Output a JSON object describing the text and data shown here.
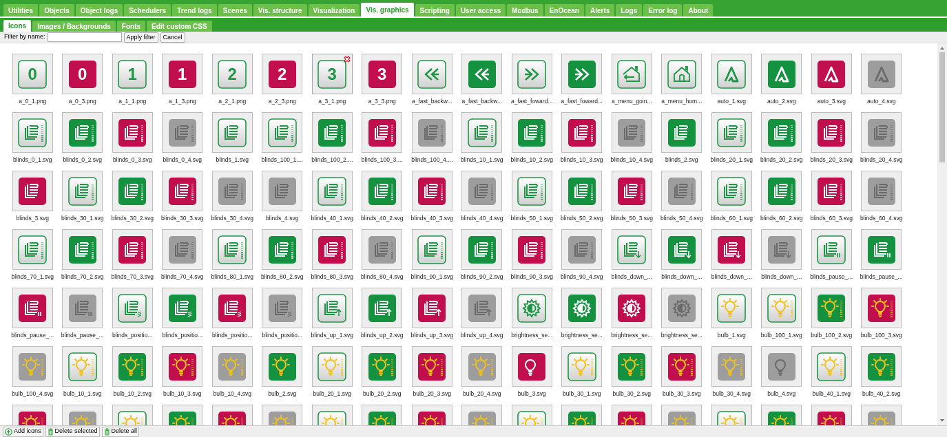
{
  "tabs": [
    {
      "label": "Utilities",
      "selected": false
    },
    {
      "label": "Objects",
      "selected": false
    },
    {
      "label": "Object logs",
      "selected": false
    },
    {
      "label": "Schedulers",
      "selected": false
    },
    {
      "label": "Trend logs",
      "selected": false
    },
    {
      "label": "Scenes",
      "selected": false
    },
    {
      "label": "Vis. structure",
      "selected": false
    },
    {
      "label": "Visualization",
      "selected": false
    },
    {
      "label": "Vis. graphics",
      "selected": true
    },
    {
      "label": "Scripting",
      "selected": false
    },
    {
      "label": "User access",
      "selected": false
    },
    {
      "label": "Modbus",
      "selected": false
    },
    {
      "label": "EnOcean",
      "selected": false
    },
    {
      "label": "Alerts",
      "selected": false
    },
    {
      "label": "Logs",
      "selected": false
    },
    {
      "label": "Error log",
      "selected": false
    },
    {
      "label": "About",
      "selected": false
    }
  ],
  "subtabs": [
    {
      "label": "Icons",
      "selected": true
    },
    {
      "label": "Images / Backgrounds",
      "selected": false
    },
    {
      "label": "Fonts",
      "selected": false
    },
    {
      "label": "Edit custom CSS",
      "selected": false
    }
  ],
  "filter": {
    "label": "Filter by name:",
    "buttons": [
      "Apply filter",
      "Cancel"
    ]
  },
  "icons": [
    {
      "name": "a_0_1.png",
      "kind": "digit",
      "text": "0",
      "filled": false,
      "color": "#1f9646",
      "scale": false,
      "marked": false
    },
    {
      "name": "a_0_3.png",
      "kind": "digit",
      "text": "0",
      "filled": true,
      "color": "#c10e4d",
      "scale": false,
      "marked": false
    },
    {
      "name": "a_1_1.png",
      "kind": "digit",
      "text": "1",
      "filled": false,
      "color": "#1f9646",
      "scale": false,
      "marked": false
    },
    {
      "name": "a_1_3.png",
      "kind": "digit",
      "text": "1",
      "filled": true,
      "color": "#c10e4d",
      "scale": false,
      "marked": false
    },
    {
      "name": "a_2_1.png",
      "kind": "digit",
      "text": "2",
      "filled": false,
      "color": "#1f9646",
      "scale": false,
      "marked": false
    },
    {
      "name": "a_2_3.png",
      "kind": "digit",
      "text": "2",
      "filled": true,
      "color": "#c10e4d",
      "scale": false,
      "marked": false
    },
    {
      "name": "a_3_1.png",
      "kind": "digit",
      "text": "3",
      "filled": false,
      "color": "#1f9646",
      "scale": false,
      "marked": true
    },
    {
      "name": "a_3_3.png",
      "kind": "digit",
      "text": "3",
      "filled": true,
      "color": "#c10e4d",
      "scale": false,
      "marked": false
    },
    {
      "name": "a_fast_backw...",
      "kind": "rewind",
      "filled": false,
      "color": "#1f9646",
      "scale": false,
      "marked": false
    },
    {
      "name": "a_fast_backw...",
      "kind": "rewind",
      "filled": true,
      "color": "#14923f",
      "scale": false,
      "marked": false
    },
    {
      "name": "a_fast_foward...",
      "kind": "forward",
      "filled": false,
      "color": "#1f9646",
      "scale": false,
      "marked": false
    },
    {
      "name": "a_fast_foward...",
      "kind": "forward",
      "filled": true,
      "color": "#14923f",
      "scale": false,
      "marked": false
    },
    {
      "name": "a_menu_goin...",
      "kind": "home_back",
      "filled": false,
      "color": "#1f9646",
      "scale": false,
      "marked": false
    },
    {
      "name": "a_menu_hom...",
      "kind": "home",
      "filled": false,
      "color": "#1f9646",
      "scale": false,
      "marked": false
    },
    {
      "name": "auto_1.svg",
      "kind": "auto",
      "filled": false,
      "color": "#1f9646",
      "scale": false,
      "marked": false
    },
    {
      "name": "auto_2.svg",
      "kind": "auto",
      "filled": true,
      "color": "#14923f",
      "scale": false,
      "marked": false
    },
    {
      "name": "auto_3.svg",
      "kind": "auto",
      "filled": true,
      "color": "#c10e4d",
      "scale": false,
      "marked": false
    },
    {
      "name": "auto_4.svg",
      "kind": "auto",
      "filled": true,
      "color": "#9d9d9d",
      "scale": false,
      "marked": false
    },
    {
      "name": "blinds_0_1.svg",
      "kind": "blinds",
      "filled": false,
      "color": "#1f9646",
      "scale": true,
      "marked": false
    },
    {
      "name": "blinds_0_2.svg",
      "kind": "blinds",
      "filled": true,
      "color": "#14923f",
      "scale": true,
      "marked": false
    },
    {
      "name": "blinds_0_3.svg",
      "kind": "blinds",
      "filled": true,
      "color": "#c10e4d",
      "scale": true,
      "marked": false
    },
    {
      "name": "blinds_0_4.svg",
      "kind": "blinds",
      "filled": true,
      "color": "#9d9d9d",
      "scale": true,
      "marked": false
    },
    {
      "name": "blinds_1.svg",
      "kind": "blinds",
      "filled": false,
      "color": "#1f9646",
      "scale": false,
      "marked": false
    },
    {
      "name": "blinds_100_1....",
      "kind": "blinds",
      "filled": false,
      "color": "#1f9646",
      "scale": true,
      "marked": false
    },
    {
      "name": "blinds_100_2....",
      "kind": "blinds",
      "filled": true,
      "color": "#14923f",
      "scale": true,
      "marked": false
    },
    {
      "name": "blinds_100_3....",
      "kind": "blinds",
      "filled": true,
      "color": "#c10e4d",
      "scale": true,
      "marked": false
    },
    {
      "name": "blinds_100_4....",
      "kind": "blinds",
      "filled": true,
      "color": "#9d9d9d",
      "scale": true,
      "marked": false
    },
    {
      "name": "blinds_10_1.svg",
      "kind": "blinds",
      "filled": false,
      "color": "#1f9646",
      "scale": true,
      "marked": false
    },
    {
      "name": "blinds_10_2.svg",
      "kind": "blinds",
      "filled": true,
      "color": "#14923f",
      "scale": true,
      "marked": false
    },
    {
      "name": "blinds_10_3.svg",
      "kind": "blinds",
      "filled": true,
      "color": "#c10e4d",
      "scale": true,
      "marked": false
    },
    {
      "name": "blinds_10_4.svg",
      "kind": "blinds",
      "filled": true,
      "color": "#9d9d9d",
      "scale": true,
      "marked": false
    },
    {
      "name": "blinds_2.svg",
      "kind": "blinds",
      "filled": true,
      "color": "#14923f",
      "scale": false,
      "marked": false
    },
    {
      "name": "blinds_20_1.svg",
      "kind": "blinds",
      "filled": false,
      "color": "#1f9646",
      "scale": true,
      "marked": false
    },
    {
      "name": "blinds_20_2.svg",
      "kind": "blinds",
      "filled": true,
      "color": "#14923f",
      "scale": true,
      "marked": false
    },
    {
      "name": "blinds_20_3.svg",
      "kind": "blinds",
      "filled": true,
      "color": "#c10e4d",
      "scale": true,
      "marked": false
    },
    {
      "name": "blinds_20_4.svg",
      "kind": "blinds",
      "filled": true,
      "color": "#9d9d9d",
      "scale": true,
      "marked": false
    },
    {
      "name": "blinds_3.svg",
      "kind": "blinds",
      "filled": true,
      "color": "#c10e4d",
      "scale": false,
      "marked": false
    },
    {
      "name": "blinds_30_1.svg",
      "kind": "blinds",
      "filled": false,
      "color": "#1f9646",
      "scale": true,
      "marked": false
    },
    {
      "name": "blinds_30_2.svg",
      "kind": "blinds",
      "filled": true,
      "color": "#14923f",
      "scale": true,
      "marked": false
    },
    {
      "name": "blinds_30_3.svg",
      "kind": "blinds",
      "filled": true,
      "color": "#c10e4d",
      "scale": true,
      "marked": false
    },
    {
      "name": "blinds_30_4.svg",
      "kind": "blinds",
      "filled": true,
      "color": "#9d9d9d",
      "scale": true,
      "marked": false
    },
    {
      "name": "blinds_4.svg",
      "kind": "blinds",
      "filled": true,
      "color": "#9d9d9d",
      "scale": false,
      "marked": false
    },
    {
      "name": "blinds_40_1.svg",
      "kind": "blinds",
      "filled": false,
      "color": "#1f9646",
      "scale": true,
      "marked": false
    },
    {
      "name": "blinds_40_2.svg",
      "kind": "blinds",
      "filled": true,
      "color": "#14923f",
      "scale": true,
      "marked": false
    },
    {
      "name": "blinds_40_3.svg",
      "kind": "blinds",
      "filled": true,
      "color": "#c10e4d",
      "scale": true,
      "marked": false
    },
    {
      "name": "blinds_40_4.svg",
      "kind": "blinds",
      "filled": true,
      "color": "#9d9d9d",
      "scale": true,
      "marked": false
    },
    {
      "name": "blinds_50_1.svg",
      "kind": "blinds",
      "filled": false,
      "color": "#1f9646",
      "scale": true,
      "marked": false
    },
    {
      "name": "blinds_50_2.svg",
      "kind": "blinds",
      "filled": true,
      "color": "#14923f",
      "scale": true,
      "marked": false
    },
    {
      "name": "blinds_50_3.svg",
      "kind": "blinds",
      "filled": true,
      "color": "#c10e4d",
      "scale": true,
      "marked": false
    },
    {
      "name": "blinds_50_4.svg",
      "kind": "blinds",
      "filled": true,
      "color": "#9d9d9d",
      "scale": true,
      "marked": false
    },
    {
      "name": "blinds_60_1.svg",
      "kind": "blinds",
      "filled": false,
      "color": "#1f9646",
      "scale": true,
      "marked": false
    },
    {
      "name": "blinds_60_2.svg",
      "kind": "blinds",
      "filled": true,
      "color": "#14923f",
      "scale": true,
      "marked": false
    },
    {
      "name": "blinds_60_3.svg",
      "kind": "blinds",
      "filled": true,
      "color": "#c10e4d",
      "scale": true,
      "marked": false
    },
    {
      "name": "blinds_60_4.svg",
      "kind": "blinds",
      "filled": true,
      "color": "#9d9d9d",
      "scale": true,
      "marked": false
    },
    {
      "name": "blinds_70_1.svg",
      "kind": "blinds",
      "filled": false,
      "color": "#1f9646",
      "scale": true,
      "marked": false
    },
    {
      "name": "blinds_70_2.svg",
      "kind": "blinds",
      "filled": true,
      "color": "#14923f",
      "scale": true,
      "marked": false
    },
    {
      "name": "blinds_70_3.svg",
      "kind": "blinds",
      "filled": true,
      "color": "#c10e4d",
      "scale": true,
      "marked": false
    },
    {
      "name": "blinds_70_4.svg",
      "kind": "blinds",
      "filled": true,
      "color": "#9d9d9d",
      "scale": true,
      "marked": false
    },
    {
      "name": "blinds_80_1.svg",
      "kind": "blinds",
      "filled": false,
      "color": "#1f9646",
      "scale": true,
      "marked": false
    },
    {
      "name": "blinds_80_2.svg",
      "kind": "blinds",
      "filled": true,
      "color": "#14923f",
      "scale": true,
      "marked": false
    },
    {
      "name": "blinds_80_3.svg",
      "kind": "blinds",
      "filled": true,
      "color": "#c10e4d",
      "scale": true,
      "marked": false
    },
    {
      "name": "blinds_80_4.svg",
      "kind": "blinds",
      "filled": true,
      "color": "#9d9d9d",
      "scale": true,
      "marked": false
    },
    {
      "name": "blinds_90_1.svg",
      "kind": "blinds",
      "filled": false,
      "color": "#1f9646",
      "scale": true,
      "marked": false
    },
    {
      "name": "blinds_90_2.svg",
      "kind": "blinds",
      "filled": true,
      "color": "#14923f",
      "scale": true,
      "marked": false
    },
    {
      "name": "blinds_90_3.svg",
      "kind": "blinds",
      "filled": true,
      "color": "#c10e4d",
      "scale": true,
      "marked": false
    },
    {
      "name": "blinds_90_4.svg",
      "kind": "blinds",
      "filled": true,
      "color": "#9d9d9d",
      "scale": true,
      "marked": false
    },
    {
      "name": "blinds_down_...",
      "kind": "blinds_down",
      "filled": false,
      "color": "#1f9646",
      "scale": false,
      "marked": false
    },
    {
      "name": "blinds_down_...",
      "kind": "blinds_down",
      "filled": true,
      "color": "#14923f",
      "scale": false,
      "marked": false
    },
    {
      "name": "blinds_down_...",
      "kind": "blinds_down",
      "filled": true,
      "color": "#c10e4d",
      "scale": false,
      "marked": false
    },
    {
      "name": "blinds_down_...",
      "kind": "blinds_down",
      "filled": true,
      "color": "#9d9d9d",
      "scale": false,
      "marked": false
    },
    {
      "name": "blinds_pause_...",
      "kind": "blinds_pause",
      "filled": false,
      "color": "#1f9646",
      "scale": false,
      "marked": false
    },
    {
      "name": "blinds_pause_...",
      "kind": "blinds_pause",
      "filled": true,
      "color": "#14923f",
      "scale": false,
      "marked": false
    },
    {
      "name": "blinds_pause_...",
      "kind": "blinds_pause",
      "filled": true,
      "color": "#c10e4d",
      "scale": false,
      "marked": false
    },
    {
      "name": "blinds_pause_...",
      "kind": "blinds_pause",
      "filled": true,
      "color": "#9d9d9d",
      "scale": false,
      "marked": false
    },
    {
      "name": "blinds_positio...",
      "kind": "blinds_position",
      "filled": false,
      "color": "#1f9646",
      "scale": false,
      "marked": false
    },
    {
      "name": "blinds_positio...",
      "kind": "blinds_position",
      "filled": true,
      "color": "#14923f",
      "scale": false,
      "marked": false
    },
    {
      "name": "blinds_positio...",
      "kind": "blinds_position",
      "filled": true,
      "color": "#c10e4d",
      "scale": false,
      "marked": false
    },
    {
      "name": "blinds_positio...",
      "kind": "blinds_position",
      "filled": true,
      "color": "#9d9d9d",
      "scale": false,
      "marked": false
    },
    {
      "name": "blinds_up_1.svg",
      "kind": "blinds_up",
      "filled": false,
      "color": "#1f9646",
      "scale": false,
      "marked": false
    },
    {
      "name": "blinds_up_2.svg",
      "kind": "blinds_up",
      "filled": true,
      "color": "#14923f",
      "scale": false,
      "marked": false
    },
    {
      "name": "blinds_up_3.svg",
      "kind": "blinds_up",
      "filled": true,
      "color": "#c10e4d",
      "scale": false,
      "marked": false
    },
    {
      "name": "blinds_up_4.svg",
      "kind": "blinds_up",
      "filled": true,
      "color": "#9d9d9d",
      "scale": false,
      "marked": false
    },
    {
      "name": "brightness_se...",
      "kind": "brightness",
      "filled": false,
      "color": "#1f9646",
      "scale": false,
      "marked": false
    },
    {
      "name": "brightness_se...",
      "kind": "brightness",
      "filled": true,
      "color": "#14923f",
      "scale": false,
      "marked": false
    },
    {
      "name": "brightness_se...",
      "kind": "brightness",
      "filled": true,
      "color": "#c10e4d",
      "scale": false,
      "marked": false
    },
    {
      "name": "brightness_se...",
      "kind": "brightness",
      "filled": true,
      "color": "#9d9d9d",
      "scale": false,
      "marked": false
    },
    {
      "name": "bulb_1.svg",
      "kind": "bulb",
      "filled": false,
      "color": "#1f9646",
      "scale": false,
      "marked": false
    },
    {
      "name": "bulb_100_1.svg",
      "kind": "bulb",
      "filled": false,
      "color": "#1f9646",
      "scale": true,
      "marked": false
    },
    {
      "name": "bulb_100_2.svg",
      "kind": "bulb",
      "filled": true,
      "color": "#14923f",
      "scale": true,
      "marked": false
    },
    {
      "name": "bulb_100_3.svg",
      "kind": "bulb",
      "filled": true,
      "color": "#c10e4d",
      "scale": true,
      "marked": false
    },
    {
      "name": "bulb_100_4.svg",
      "kind": "bulb",
      "filled": true,
      "color": "#9d9d9d",
      "scale": true,
      "marked": false
    },
    {
      "name": "bulb_10_1.svg",
      "kind": "bulb",
      "filled": false,
      "color": "#1f9646",
      "scale": true,
      "marked": false
    },
    {
      "name": "bulb_10_2.svg",
      "kind": "bulb",
      "filled": true,
      "color": "#14923f",
      "scale": true,
      "marked": false
    },
    {
      "name": "bulb_10_3.svg",
      "kind": "bulb",
      "filled": true,
      "color": "#c10e4d",
      "scale": true,
      "marked": false
    },
    {
      "name": "bulb_10_4.svg",
      "kind": "bulb",
      "filled": true,
      "color": "#9d9d9d",
      "scale": true,
      "marked": false
    },
    {
      "name": "bulb_2.svg",
      "kind": "bulb",
      "filled": true,
      "color": "#14923f",
      "scale": false,
      "marked": false
    },
    {
      "name": "bulb_20_1.svg",
      "kind": "bulb",
      "filled": false,
      "color": "#1f9646",
      "scale": true,
      "marked": false
    },
    {
      "name": "bulb_20_2.svg",
      "kind": "bulb",
      "filled": true,
      "color": "#14923f",
      "scale": true,
      "marked": false
    },
    {
      "name": "bulb_20_3.svg",
      "kind": "bulb",
      "filled": true,
      "color": "#c10e4d",
      "scale": true,
      "marked": false
    },
    {
      "name": "bulb_20_4.svg",
      "kind": "bulb",
      "filled": true,
      "color": "#9d9d9d",
      "scale": true,
      "marked": false
    },
    {
      "name": "bulb_3.svg",
      "kind": "bulb_plain",
      "filled": true,
      "color": "#c10e4d",
      "scale": false,
      "marked": false
    },
    {
      "name": "bulb_30_1.svg",
      "kind": "bulb",
      "filled": false,
      "color": "#1f9646",
      "scale": true,
      "marked": false
    },
    {
      "name": "bulb_30_2.svg",
      "kind": "bulb",
      "filled": true,
      "color": "#14923f",
      "scale": true,
      "marked": false
    },
    {
      "name": "bulb_30_3.svg",
      "kind": "bulb",
      "filled": true,
      "color": "#c10e4d",
      "scale": true,
      "marked": false
    },
    {
      "name": "bulb_30_4.svg",
      "kind": "bulb",
      "filled": true,
      "color": "#9d9d9d",
      "scale": true,
      "marked": false
    },
    {
      "name": "bulb_4.svg",
      "kind": "bulb_plain",
      "filled": true,
      "color": "#9d9d9d",
      "scale": false,
      "marked": false
    },
    {
      "name": "bulb_40_1.svg",
      "kind": "bulb",
      "filled": false,
      "color": "#1f9646",
      "scale": true,
      "marked": false
    },
    {
      "name": "bulb_40_2.svg",
      "kind": "bulb",
      "filled": true,
      "color": "#14923f",
      "scale": true,
      "marked": false
    },
    {
      "kind": "bulb",
      "filled": true,
      "color": "#c10e4d",
      "scale": true,
      "marked": false
    },
    {
      "kind": "bulb",
      "filled": true,
      "color": "#9d9d9d",
      "scale": true,
      "marked": false
    },
    {
      "kind": "bulb",
      "filled": false,
      "color": "#1f9646",
      "scale": true,
      "marked": false
    },
    {
      "kind": "bulb",
      "filled": true,
      "color": "#14923f",
      "scale": true,
      "marked": false
    },
    {
      "kind": "bulb",
      "filled": true,
      "color": "#c10e4d",
      "scale": true,
      "marked": false
    },
    {
      "kind": "bulb",
      "filled": true,
      "color": "#9d9d9d",
      "scale": true,
      "marked": false
    },
    {
      "kind": "bulb",
      "filled": false,
      "color": "#1f9646",
      "scale": true,
      "marked": false
    },
    {
      "kind": "bulb",
      "filled": true,
      "color": "#14923f",
      "scale": true,
      "marked": false
    },
    {
      "kind": "bulb",
      "filled": true,
      "color": "#c10e4d",
      "scale": true,
      "marked": false
    },
    {
      "kind": "bulb",
      "filled": true,
      "color": "#9d9d9d",
      "scale": true,
      "marked": false
    },
    {
      "kind": "bulb",
      "filled": false,
      "color": "#1f9646",
      "scale": true,
      "marked": false
    },
    {
      "kind": "bulb",
      "filled": true,
      "color": "#14923f",
      "scale": true,
      "marked": false
    },
    {
      "kind": "bulb",
      "filled": true,
      "color": "#c10e4d",
      "scale": true,
      "marked": false
    },
    {
      "kind": "bulb",
      "filled": true,
      "color": "#9d9d9d",
      "scale": true,
      "marked": false
    },
    {
      "kind": "bulb",
      "filled": false,
      "color": "#1f9646",
      "scale": true,
      "marked": false
    },
    {
      "kind": "bulb",
      "filled": true,
      "color": "#14923f",
      "scale": true,
      "marked": false
    },
    {
      "kind": "bulb",
      "filled": true,
      "color": "#c10e4d",
      "scale": true,
      "marked": false
    },
    {
      "kind": "bulb",
      "filled": true,
      "color": "#9d9d9d",
      "scale": true,
      "marked": false
    }
  ],
  "toolbar": [
    {
      "label": "Add icons",
      "kind": "add"
    },
    {
      "label": "Delete selected",
      "kind": "delete"
    },
    {
      "label": "Delete all",
      "kind": "delete"
    }
  ]
}
